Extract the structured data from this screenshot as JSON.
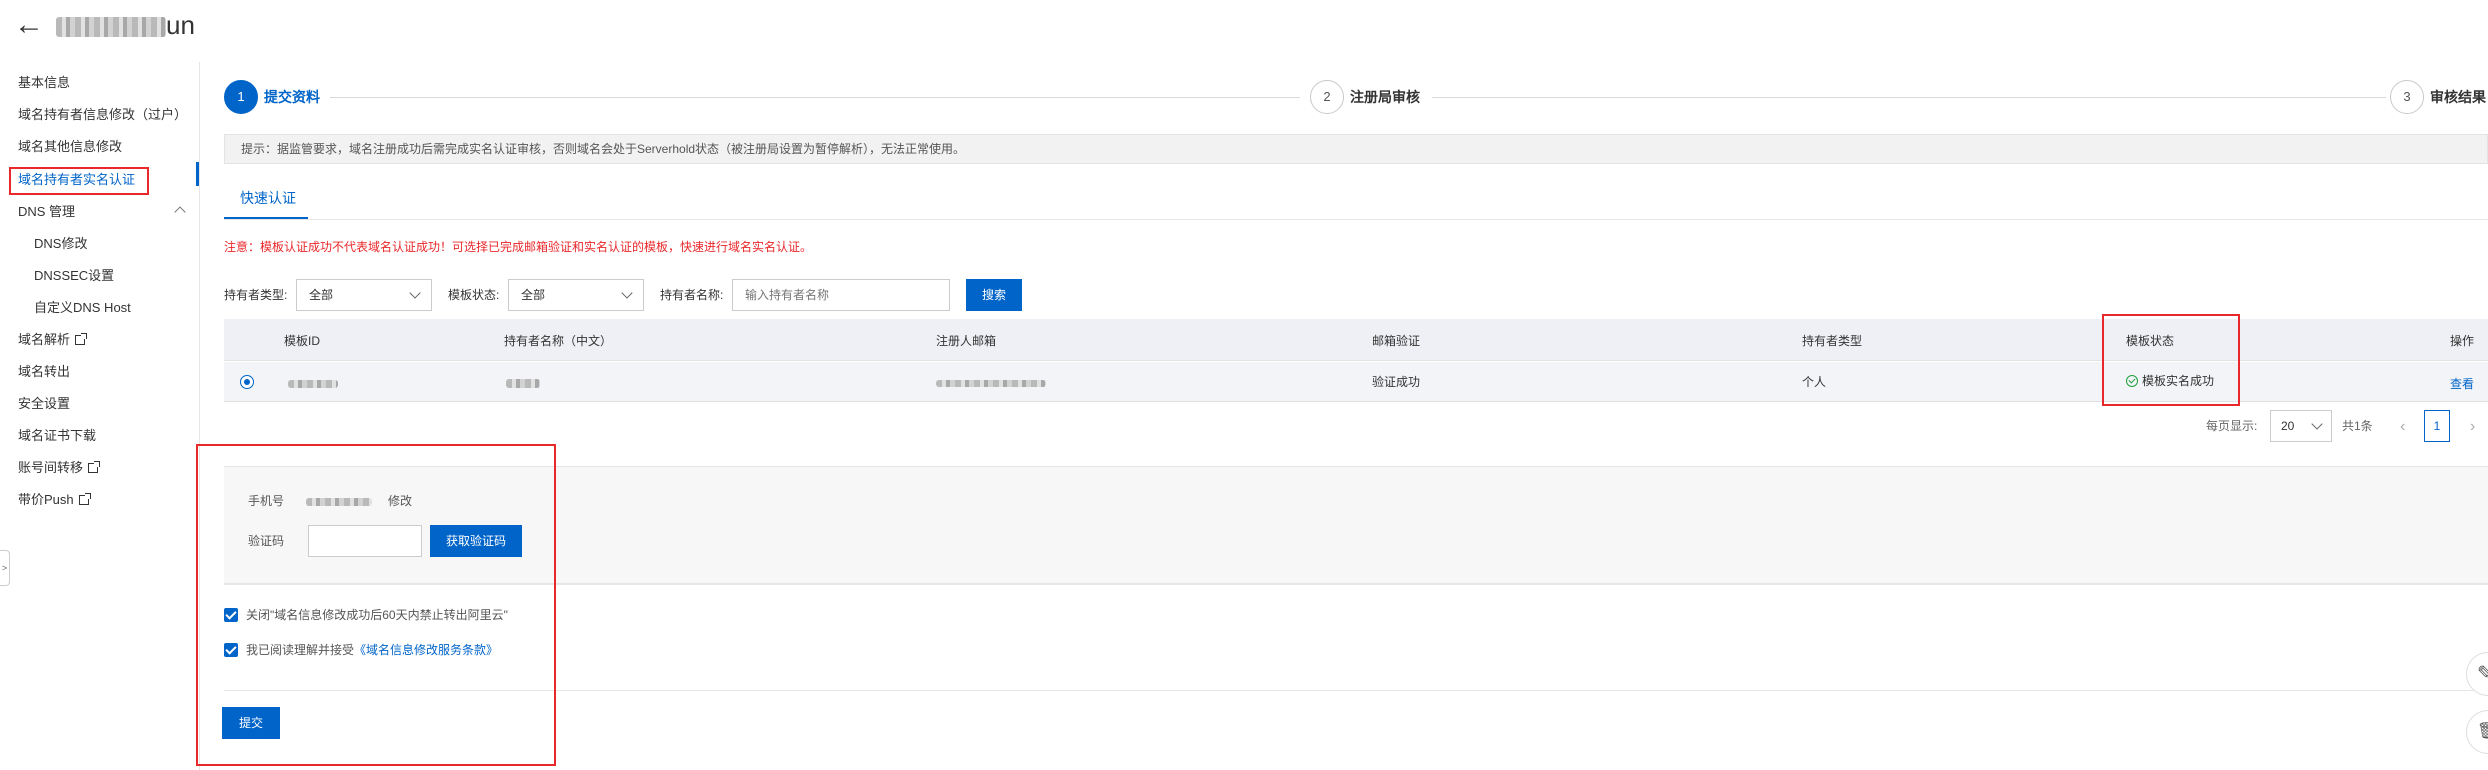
{
  "header": {
    "back_icon": "arrow-left-icon",
    "title_suffix": "un"
  },
  "sidebar": {
    "items": [
      {
        "label": "基本信息"
      },
      {
        "label": "域名持有者信息修改（过户）"
      },
      {
        "label": "域名其他信息修改"
      },
      {
        "label": "域名持有者实名认证",
        "active": true
      },
      {
        "label": "DNS 管理"
      },
      {
        "label": "DNS修改"
      },
      {
        "label": "DNSSEC设置"
      },
      {
        "label": "自定义DNS Host"
      },
      {
        "label": "域名解析"
      },
      {
        "label": "域名转出"
      },
      {
        "label": "安全设置"
      },
      {
        "label": "域名证书下载"
      },
      {
        "label": "账号间转移"
      },
      {
        "label": "带价Push"
      }
    ],
    "collapse_glyph": ">"
  },
  "steps": [
    {
      "num": "1",
      "label": "提交资料",
      "active": true
    },
    {
      "num": "2",
      "label": "注册局审核"
    },
    {
      "num": "3",
      "label": "审核结果"
    }
  ],
  "notice": "提示：据监管要求，域名注册成功后需完成实名认证审核，否则域名会处于Serverhold状态（被注册局设置为暂停解析），无法正常使用。",
  "tab": {
    "label": "快速认证"
  },
  "warning": "注意：模板认证成功不代表域名认证成功！可选择已完成邮箱验证和实名认证的模板，快速进行域名实名认证。",
  "filters": {
    "holder_type_label": "持有者类型:",
    "holder_type_value": "全部",
    "template_status_label": "模板状态:",
    "template_status_value": "全部",
    "holder_name_label": "持有者名称:",
    "holder_name_placeholder": "输入持有者名称",
    "search_button": "搜索"
  },
  "table": {
    "headers": [
      "模板ID",
      "持有者名称（中文）",
      "注册人邮箱",
      "邮箱验证",
      "持有者类型",
      "模板状态",
      "操作"
    ],
    "rows": [
      {
        "email_verify": "验证成功",
        "holder_type": "个人",
        "status": "模板实名成功",
        "action": "查看"
      }
    ]
  },
  "pagination": {
    "per_page_label": "每页显示:",
    "per_page_value": "20",
    "total": "共1条",
    "current": "1",
    "prev": "‹",
    "next": "›"
  },
  "verify": {
    "phone_label": "手机号",
    "modify_link": "修改",
    "code_label": "验证码",
    "get_code_button": "获取验证码"
  },
  "agreements": {
    "close_text": "关闭\"域名信息修改成功后60天内禁止转出阿里云\"",
    "read_text": "我已阅读理解并接受",
    "terms_link": "《域名信息修改服务条款》"
  },
  "submit_button": "提交",
  "float_icons": {
    "edit": "✎",
    "delete": "🗑"
  },
  "colors": {
    "primary": "#0064c8",
    "danger": "#e8282b",
    "success": "#1e9e3a"
  }
}
